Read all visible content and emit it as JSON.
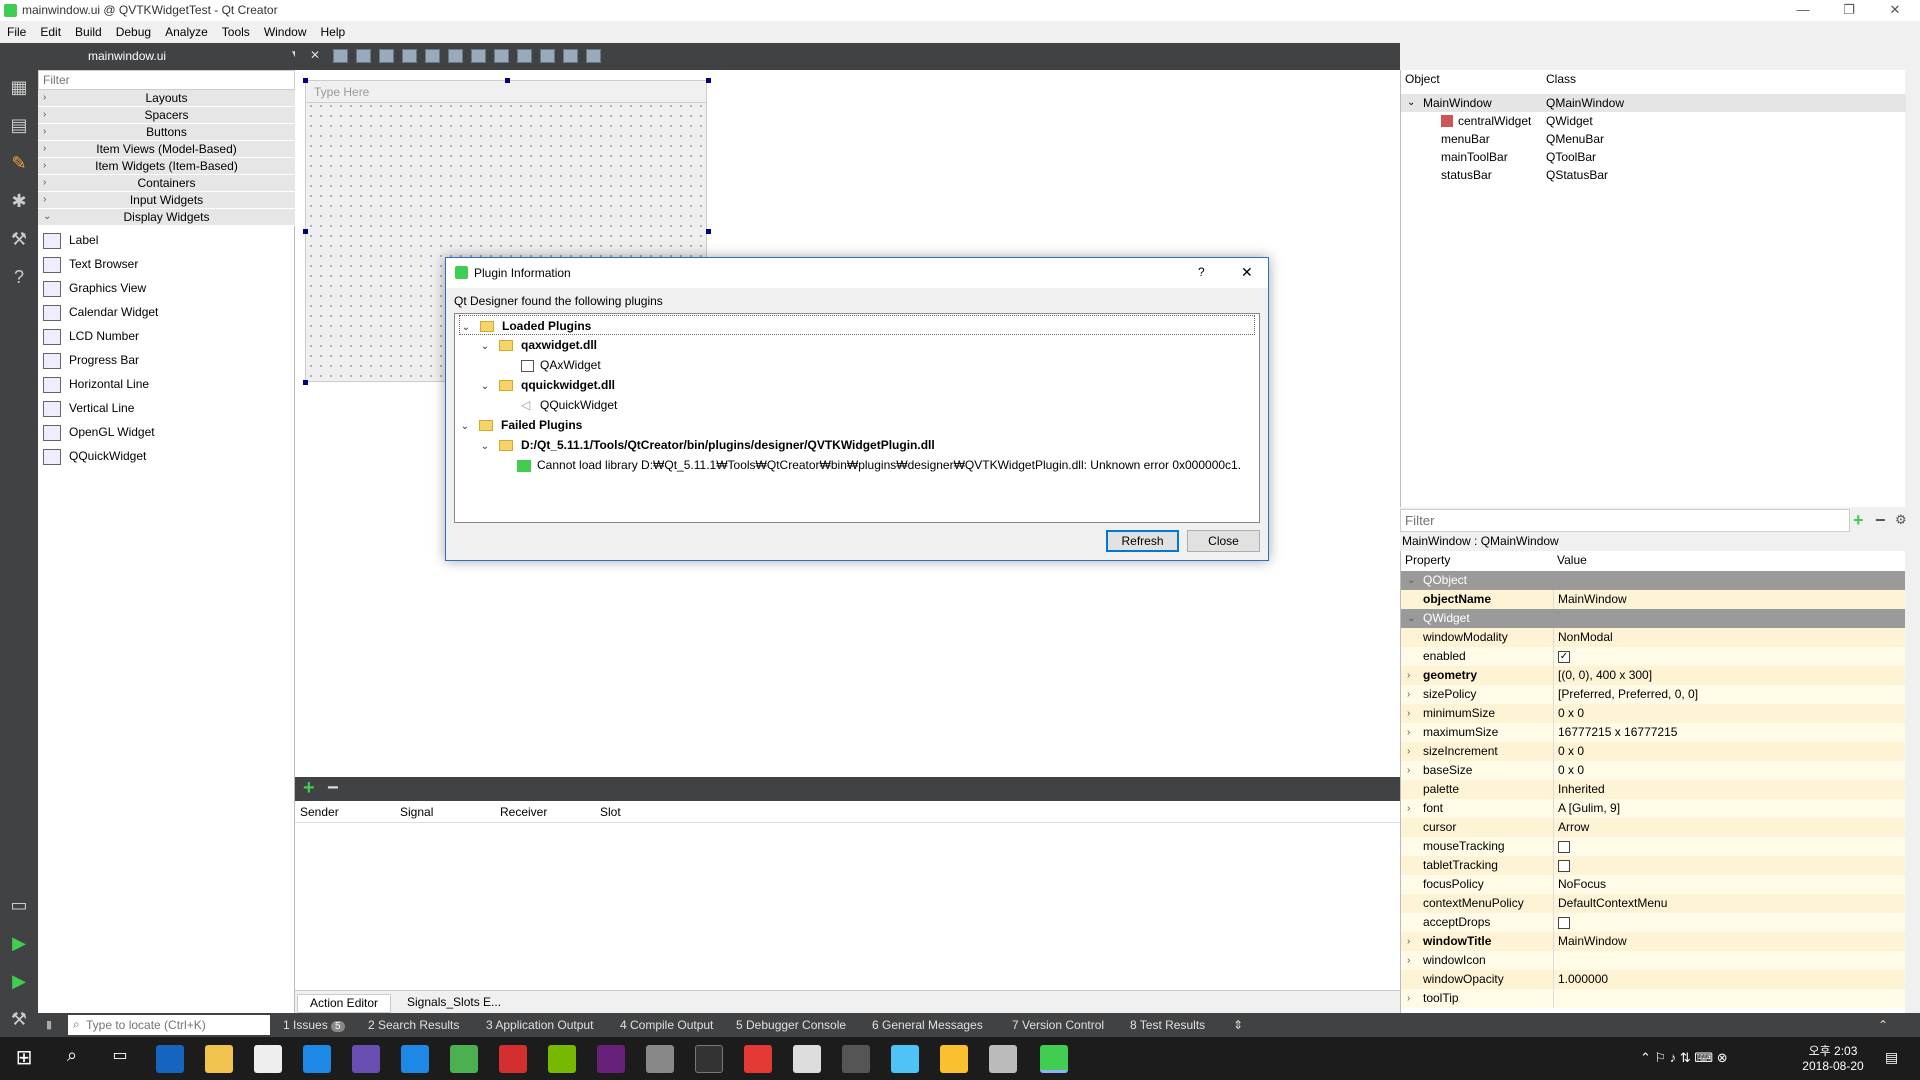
{
  "window": {
    "title": "mainwindow.ui @ QVTKWidgetTest - Qt Creator"
  },
  "menu": [
    "File",
    "Edit",
    "Build",
    "Debug",
    "Analyze",
    "Tools",
    "Window",
    "Help"
  ],
  "editor": {
    "file_tab": "mainwindow.ui"
  },
  "widget_box": {
    "filter_placeholder": "Filter",
    "categories": [
      "Layouts",
      "Spacers",
      "Buttons",
      "Item Views (Model-Based)",
      "Item Widgets (Item-Based)",
      "Containers",
      "Input Widgets",
      "Display Widgets"
    ],
    "display_widgets": [
      "Label",
      "Text Browser",
      "Graphics View",
      "Calendar Widget",
      "LCD Number",
      "Progress Bar",
      "Horizontal Line",
      "Vertical Line",
      "OpenGL Widget",
      "QQuickWidget"
    ]
  },
  "form": {
    "type_here": "Type Here"
  },
  "signal_slot": {
    "columns": [
      "Sender",
      "Signal",
      "Receiver",
      "Slot"
    ],
    "tabs": [
      "Action Editor",
      "Signals_Slots E..."
    ]
  },
  "object_inspector": {
    "headers": [
      "Object",
      "Class"
    ],
    "rows": [
      {
        "object": "MainWindow",
        "class": "QMainWindow"
      },
      {
        "object": "centralWidget",
        "class": "QWidget"
      },
      {
        "object": "menuBar",
        "class": "QMenuBar"
      },
      {
        "object": "mainToolBar",
        "class": "QToolBar"
      },
      {
        "object": "statusBar",
        "class": "QStatusBar"
      }
    ]
  },
  "property_editor": {
    "filter_placeholder": "Filter",
    "title": "MainWindow : QMainWindow",
    "headers": [
      "Property",
      "Value"
    ],
    "rows": [
      {
        "name": "QObject",
        "value": "",
        "group": true
      },
      {
        "name": "objectName",
        "value": "MainWindow",
        "bold": true
      },
      {
        "name": "QWidget",
        "value": "",
        "group": true
      },
      {
        "name": "windowModality",
        "value": "NonModal"
      },
      {
        "name": "enabled",
        "value": "",
        "check": "checked"
      },
      {
        "name": "geometry",
        "value": "[(0, 0), 400 x 300]",
        "bold": true,
        "expand": true
      },
      {
        "name": "sizePolicy",
        "value": "[Preferred, Preferred, 0, 0]",
        "expand": true
      },
      {
        "name": "minimumSize",
        "value": "0 x 0",
        "expand": true
      },
      {
        "name": "maximumSize",
        "value": "16777215 x 16777215",
        "expand": true
      },
      {
        "name": "sizeIncrement",
        "value": "0 x 0",
        "expand": true
      },
      {
        "name": "baseSize",
        "value": "0 x 0",
        "expand": true
      },
      {
        "name": "palette",
        "value": "Inherited"
      },
      {
        "name": "font",
        "value": "A  [Gulim, 9]",
        "expand": true
      },
      {
        "name": "cursor",
        "value": "Arrow"
      },
      {
        "name": "mouseTracking",
        "value": "",
        "check": "unchecked"
      },
      {
        "name": "tabletTracking",
        "value": "",
        "check": "unchecked"
      },
      {
        "name": "focusPolicy",
        "value": "NoFocus"
      },
      {
        "name": "contextMenuPolicy",
        "value": "DefaultContextMenu"
      },
      {
        "name": "acceptDrops",
        "value": "",
        "check": "unchecked"
      },
      {
        "name": "windowTitle",
        "value": "MainWindow",
        "bold": true,
        "expand": true
      },
      {
        "name": "windowIcon",
        "value": "",
        "expand": true
      },
      {
        "name": "windowOpacity",
        "value": "1.000000"
      },
      {
        "name": "toolTip",
        "value": "",
        "expand": true
      }
    ]
  },
  "output_bar": {
    "locate_placeholder": "Type to locate (Ctrl+K)",
    "tabs": [
      "1  Issues",
      "2  Search Results",
      "3  Application Output",
      "4  Compile Output",
      "5  Debugger Console",
      "6  General Messages",
      "7  Version Control",
      "8  Test Results"
    ],
    "issues_count": "5"
  },
  "dialog": {
    "title": "Plugin Information",
    "help": "?",
    "close": "✕",
    "message": "Qt Designer found the following plugins",
    "loaded": "Loaded Plugins",
    "dll1": "qaxwidget.dll",
    "dll1_item": "QAxWidget",
    "dll2": "qquickwidget.dll",
    "dll2_item": "QQuickWidget",
    "failed": "Failed Plugins",
    "failed_path": "D:/Qt_5.11.1/Tools/QtCreator/bin/plugins/designer/QVTKWidgetPlugin.dll",
    "error": "Cannot load library D:₩Qt_5.11.1₩Tools₩QtCreator₩bin₩plugins₩designer₩QVTKWidgetPlugin.dll: Unknown error 0x000000c1.",
    "refresh": "Refresh",
    "close_btn": "Close"
  },
  "clock": {
    "time": "오후 2:03",
    "date": "2018-08-20"
  }
}
